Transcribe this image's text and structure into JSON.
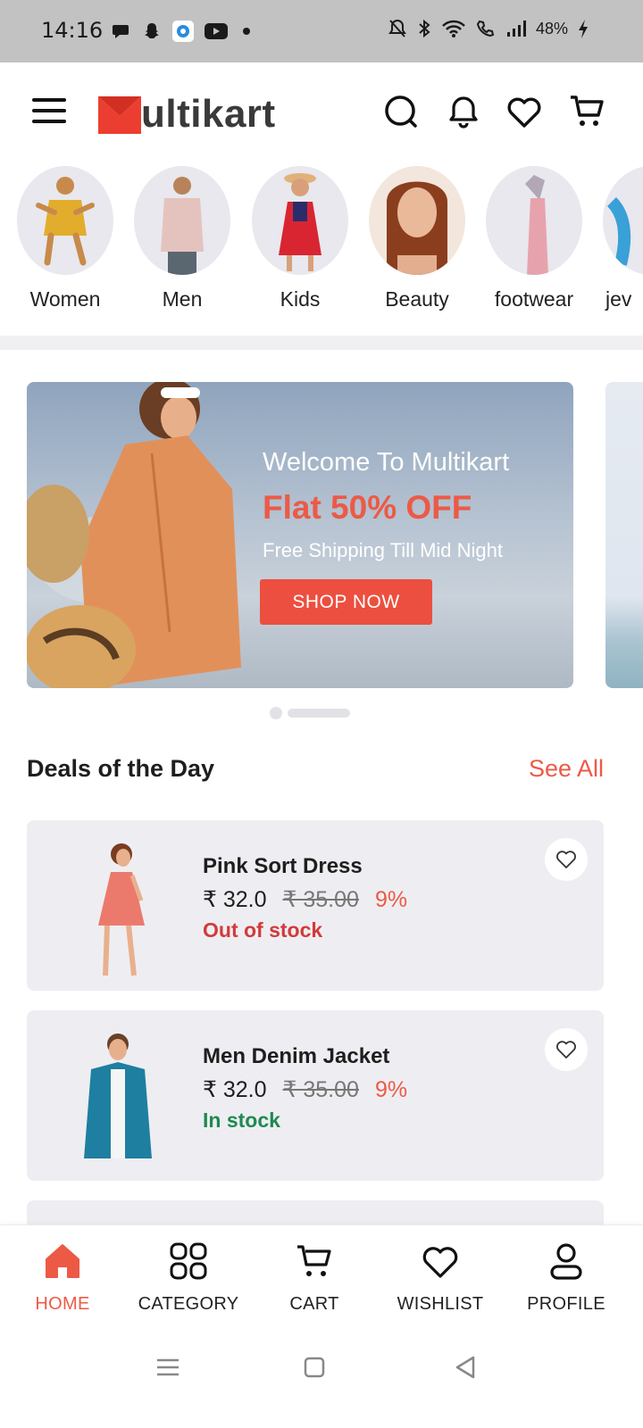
{
  "status_bar": {
    "time": "14:16",
    "battery": "48%",
    "left_icons": [
      "chat-bubble-icon",
      "snapchat-icon",
      "browser-icon",
      "youtube-icon",
      "dot-icon"
    ],
    "right_icons": [
      "mute-bell-icon",
      "bluetooth-icon",
      "wifi-icon",
      "wifi-call-icon",
      "signal-icon",
      "charging-icon"
    ]
  },
  "header": {
    "logo_first": "M",
    "logo_mid": "ulti",
    "logo_last": "kart",
    "icons": [
      "search-icon",
      "bell-icon",
      "heart-icon",
      "cart-icon"
    ]
  },
  "categories": [
    {
      "label": "Women"
    },
    {
      "label": "Men"
    },
    {
      "label": "Kids"
    },
    {
      "label": "Beauty"
    },
    {
      "label": "footwear"
    },
    {
      "label": "jev"
    }
  ],
  "banner": {
    "welcome": "Welcome To Multikart",
    "offer": "Flat 50% OFF",
    "subtitle": "Free Shipping Till Mid Night",
    "button": "SHOP NOW",
    "active_slide": 1,
    "slide_count": 2
  },
  "deals": {
    "title": "Deals of the Day",
    "see_all": "See All",
    "items": [
      {
        "name": "Pink Sort Dress",
        "price": "₹ 32.0",
        "old_price": "₹ 35.00",
        "discount": "9%",
        "stock": "Out of stock",
        "stock_color": "#d23a3a"
      },
      {
        "name": "Men Denim Jacket",
        "price": "₹ 32.0",
        "old_price": "₹ 35.00",
        "discount": "9%",
        "stock": "In stock",
        "stock_color": "#1f8a4f"
      }
    ]
  },
  "bottom_nav": {
    "items": [
      {
        "label": "HOME",
        "icon": "home-icon",
        "active": true
      },
      {
        "label": "CATEGORY",
        "icon": "grid-icon",
        "active": false
      },
      {
        "label": "CART",
        "icon": "cart-icon",
        "active": false
      },
      {
        "label": "WISHLIST",
        "icon": "heart-icon",
        "active": false
      },
      {
        "label": "PROFILE",
        "icon": "user-icon",
        "active": false
      }
    ]
  },
  "colors": {
    "accent": "#ec5a46",
    "card_bg": "#eeeef2",
    "status_bar": "#c2c2c2"
  },
  "system_nav": {
    "icons": [
      "recents-icon",
      "home-square-icon",
      "back-icon"
    ]
  }
}
